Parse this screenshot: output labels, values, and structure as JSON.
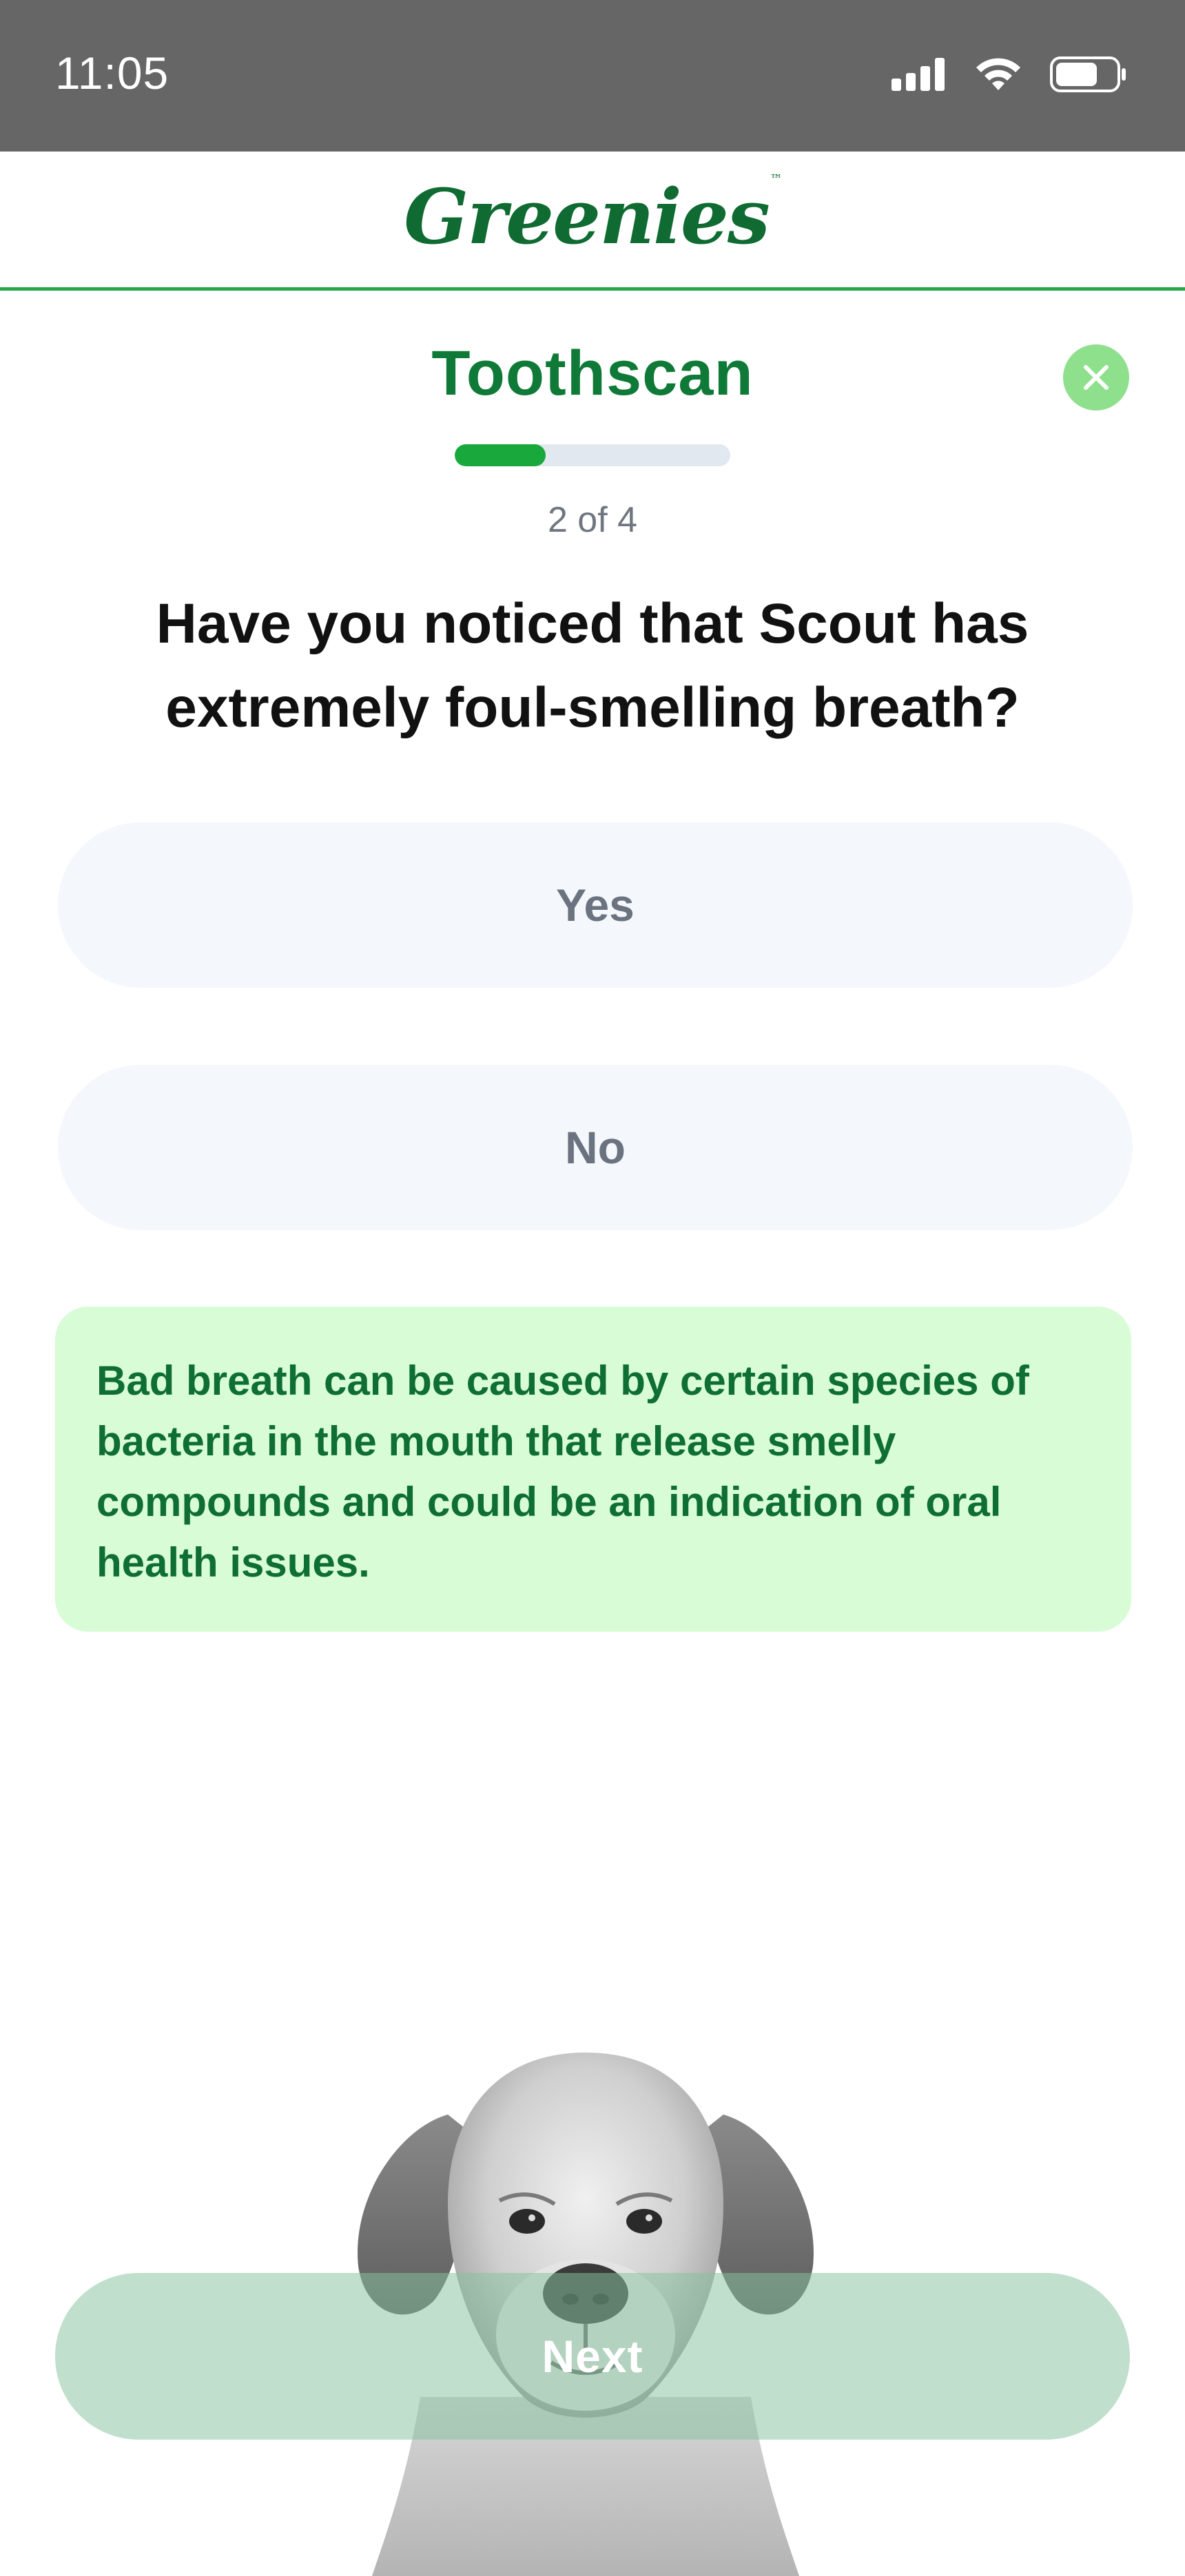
{
  "status_bar": {
    "time": "11:05",
    "icons": [
      "signal-icon",
      "wifi-icon",
      "battery-icon"
    ],
    "battery_level": 0.7
  },
  "header": {
    "logo_text": "Greenies",
    "logo_mark": "™",
    "brand_color": "#0f6b32",
    "divider_color": "#29a84a"
  },
  "quiz": {
    "title": "Toothscan",
    "close_icon": "close-icon",
    "progress": {
      "current": 2,
      "total": 4,
      "fraction": 0.33,
      "label": "2 of 4"
    },
    "question": "Have you noticed that Scout has extremely foul-smelling breath?",
    "options": [
      {
        "label": "Yes"
      },
      {
        "label": "No"
      }
    ],
    "info": "Bad breath can be caused by certain species of bacteria in the mouth that release smelly compounds and could be an indication of oral health issues.",
    "next_label": "Next"
  },
  "colors": {
    "title_green": "#0f7a37",
    "progress_fill": "#18a83c",
    "close_bg": "#8fe08d",
    "option_bg": "#f4f7fc",
    "info_bg": "#d8fcd6",
    "info_text": "#0e6e34",
    "next_bg": "#86c29e"
  }
}
